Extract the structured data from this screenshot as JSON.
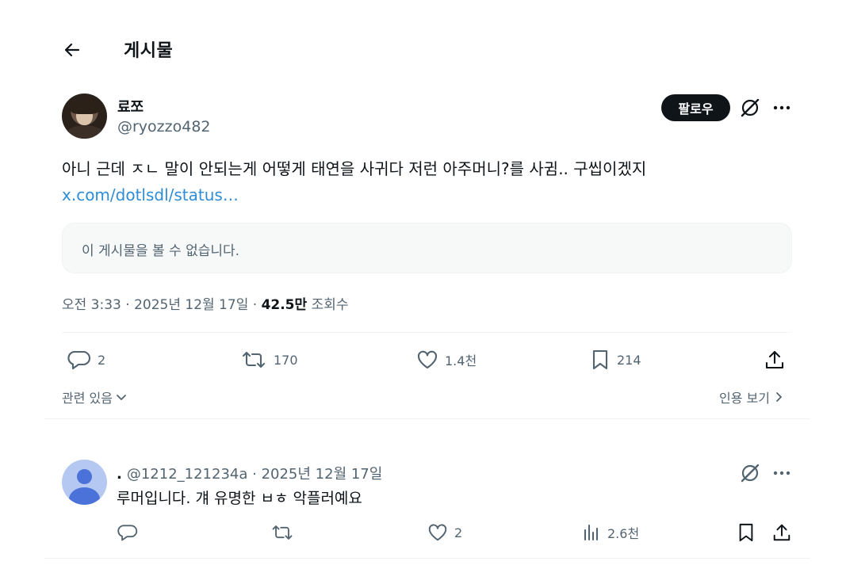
{
  "header": {
    "title": "게시물"
  },
  "post": {
    "display_name": "료쪼",
    "handle": "@ryozzo482",
    "follow_label": "팔로우",
    "text": "아니 근데 ㅈㄴ 말이 안되는게 어떻게 태연을 사귀다 저런 아주머니?를 사귐.. 구씹이겠지",
    "link": "x.com/dotlsdl/status…",
    "unavailable_notice": "이 게시물을 볼 수 없습니다.",
    "time": "오전 3:33",
    "date": "2025년 12월 17일",
    "views": "42.5만",
    "views_label": "조회수",
    "stats": {
      "replies": "2",
      "reposts": "170",
      "likes": "1.4천",
      "bookmarks": "214"
    },
    "related_label": "관련 있음",
    "quotes_label": "인용 보기"
  },
  "reply": {
    "display_name": ".",
    "handle": "@1212_121234a",
    "date": "2025년 12월 17일",
    "text": "루머입니다. 걔 유명한 ㅂㅎ 악플러예요",
    "stats": {
      "likes": "2",
      "views": "2.6천"
    }
  },
  "icons": {
    "back": "arrow-left-icon",
    "grok": "grok-icon",
    "more": "more-dots-icon",
    "reply": "reply-bubble-icon",
    "repost": "repost-icon",
    "like": "heart-icon",
    "bookmark": "bookmark-icon",
    "share": "share-icon",
    "views": "analytics-bars-icon",
    "chevron_down": "chevron-down-icon",
    "chevron_right": "chevron-right-icon"
  },
  "colors": {
    "text": "#0f1419",
    "muted": "#536471",
    "link": "#2f8dd6",
    "divider": "#eff3f4",
    "button_bg": "#0f1419"
  }
}
